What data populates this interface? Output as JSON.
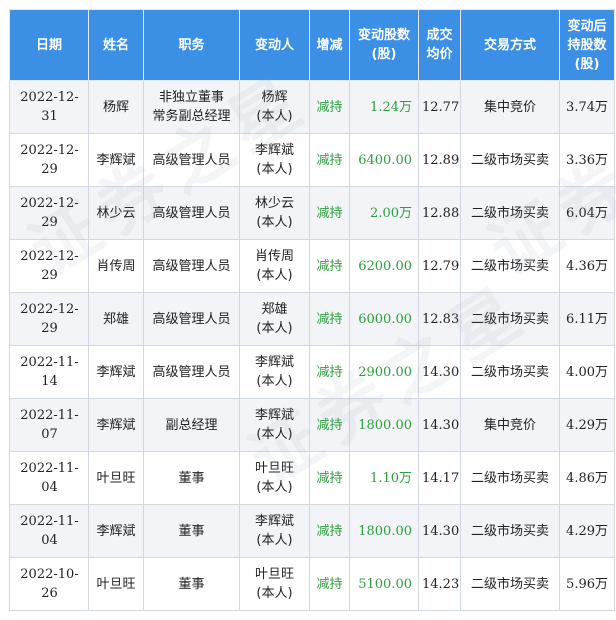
{
  "headers": {
    "date": "日期",
    "name": "姓名",
    "position": "职务",
    "changer": "变动人",
    "direction": "增减",
    "shares": "变动股数\n(股)",
    "price": "成交\n均价",
    "method": "交易方式",
    "after": "变动后\n持股数\n(股)"
  },
  "watermark": "证券之星",
  "colors": {
    "header_bg": "#3b8fe5",
    "reduce_green": "#2e9e3c",
    "row_alt": "#f2f4f7"
  },
  "rows": [
    {
      "date": "2022-12-31",
      "name": "杨辉",
      "position": "非独立董事\n常务副总经理",
      "changer": "杨辉\n(本人)",
      "direction": "减持",
      "shares": "1.24万",
      "price": "12.77",
      "method": "集中竞价",
      "after": "3.74万"
    },
    {
      "date": "2022-12-29",
      "name": "李辉斌",
      "position": "高级管理人员",
      "changer": "李辉斌\n(本人)",
      "direction": "减持",
      "shares": "6400.00",
      "price": "12.89",
      "method": "二级市场买卖",
      "after": "3.36万"
    },
    {
      "date": "2022-12-29",
      "name": "林少云",
      "position": "高级管理人员",
      "changer": "林少云\n(本人)",
      "direction": "减持",
      "shares": "2.00万",
      "price": "12.88",
      "method": "二级市场买卖",
      "after": "6.04万"
    },
    {
      "date": "2022-12-29",
      "name": "肖传周",
      "position": "高级管理人员",
      "changer": "肖传周\n(本人)",
      "direction": "减持",
      "shares": "6200.00",
      "price": "12.79",
      "method": "二级市场买卖",
      "after": "4.36万"
    },
    {
      "date": "2022-12-29",
      "name": "郑雄",
      "position": "高级管理人员",
      "changer": "郑雄\n(本人)",
      "direction": "减持",
      "shares": "6000.00",
      "price": "12.83",
      "method": "二级市场买卖",
      "after": "6.11万"
    },
    {
      "date": "2022-11-14",
      "name": "李辉斌",
      "position": "高级管理人员",
      "changer": "李辉斌\n(本人)",
      "direction": "减持",
      "shares": "2900.00",
      "price": "14.30",
      "method": "二级市场买卖",
      "after": "4.00万"
    },
    {
      "date": "2022-11-07",
      "name": "李辉斌",
      "position": "副总经理",
      "changer": "李辉斌\n(本人)",
      "direction": "减持",
      "shares": "1800.00",
      "price": "14.30",
      "method": "集中竞价",
      "after": "4.29万"
    },
    {
      "date": "2022-11-04",
      "name": "叶旦旺",
      "position": "董事",
      "changer": "叶旦旺\n(本人)",
      "direction": "减持",
      "shares": "1.10万",
      "price": "14.17",
      "method": "二级市场买卖",
      "after": "4.86万"
    },
    {
      "date": "2022-11-04",
      "name": "李辉斌",
      "position": "董事",
      "changer": "李辉斌\n(本人)",
      "direction": "减持",
      "shares": "1800.00",
      "price": "14.30",
      "method": "二级市场买卖",
      "after": "4.29万"
    },
    {
      "date": "2022-10-26",
      "name": "叶旦旺",
      "position": "董事",
      "changer": "叶旦旺\n(本人)",
      "direction": "减持",
      "shares": "5100.00",
      "price": "14.23",
      "method": "二级市场买卖",
      "after": "5.96万"
    }
  ]
}
